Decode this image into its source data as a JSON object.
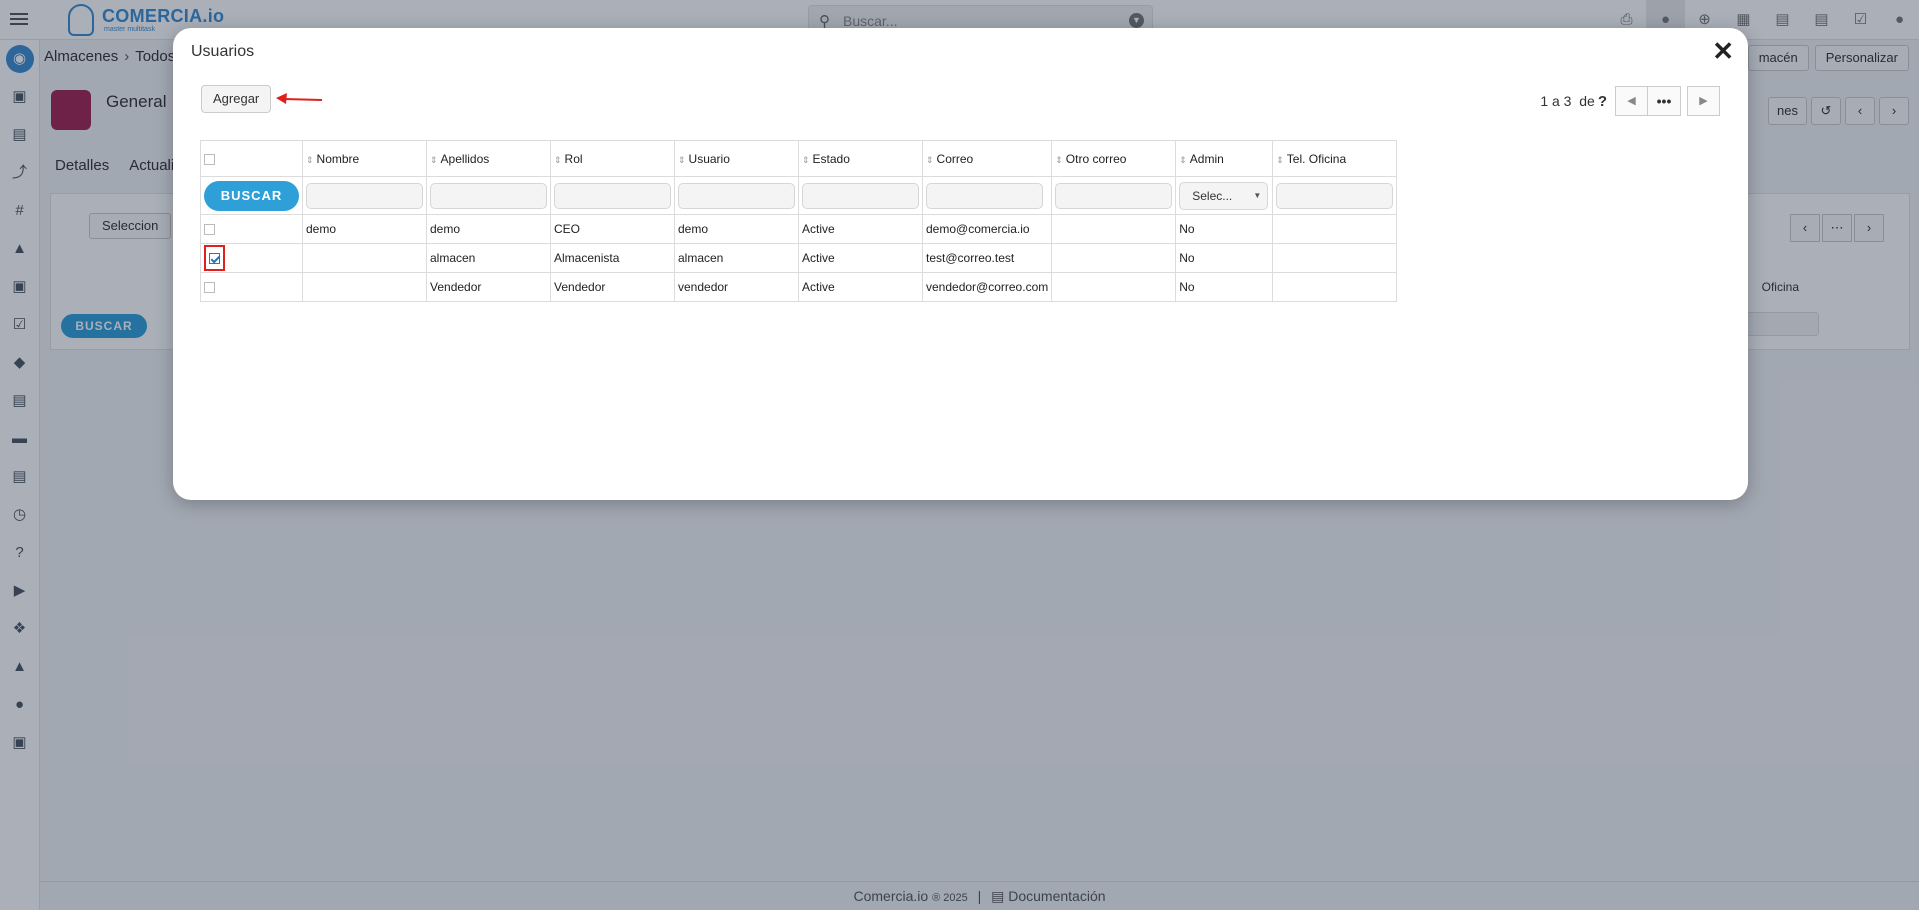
{
  "app": {
    "logo_text": "COMERCIA.io",
    "logo_sub": "master multitask",
    "search_placeholder": "Buscar...",
    "breadcrumb": [
      "Almacenes",
      "Todos"
    ],
    "record_title": "General",
    "tabs": [
      "Detalles",
      "Actuali"
    ],
    "header_buttons": [
      "macén",
      "Personalizar"
    ],
    "toolbar_btn": "nes",
    "select_btn": "Seleccion",
    "buscar": "BUSCAR",
    "col_ofic": "Oficina",
    "footer_brand": "Comercia.io",
    "footer_copy": "® 2025",
    "footer_sep": "|",
    "footer_doc": "Documentación"
  },
  "modal": {
    "title": "Usuarios",
    "close_icon": "close-icon",
    "add_label": "Agregar",
    "arrow_color": "#e0201d",
    "pager": {
      "range": "1 a 3",
      "of": "de",
      "total": "?",
      "more": "•••"
    },
    "buscar_label": "BUSCAR",
    "admin_select": "Selec...",
    "columns": [
      "Nombre",
      "Apellidos",
      "Rol",
      "Usuario",
      "Estado",
      "Correo",
      "Otro correo",
      "Admin",
      "Tel. Oficina"
    ],
    "rows": [
      {
        "checked": false,
        "nombre": "demo",
        "apellidos": "demo",
        "rol": "CEO",
        "usuario": "demo",
        "estado": "Active",
        "correo": "demo@comercia.io",
        "otro_correo": "",
        "admin": "No",
        "tel": ""
      },
      {
        "checked": true,
        "nombre": "",
        "apellidos": "almacen",
        "rol": "Almacenista",
        "usuario": "almacen",
        "estado": "Active",
        "correo": "test@correo.test",
        "otro_correo": "",
        "admin": "No",
        "tel": ""
      },
      {
        "checked": false,
        "nombre": "",
        "apellidos": "Vendedor",
        "rol": "Vendedor",
        "usuario": "vendedor",
        "estado": "Active",
        "correo": "vendedor@correo.com",
        "otro_correo": "",
        "admin": "No",
        "tel": ""
      }
    ]
  },
  "colors": {
    "accent": "#2f9fd8",
    "highlight": "#e0201d",
    "module_icon": "#a3234f"
  }
}
